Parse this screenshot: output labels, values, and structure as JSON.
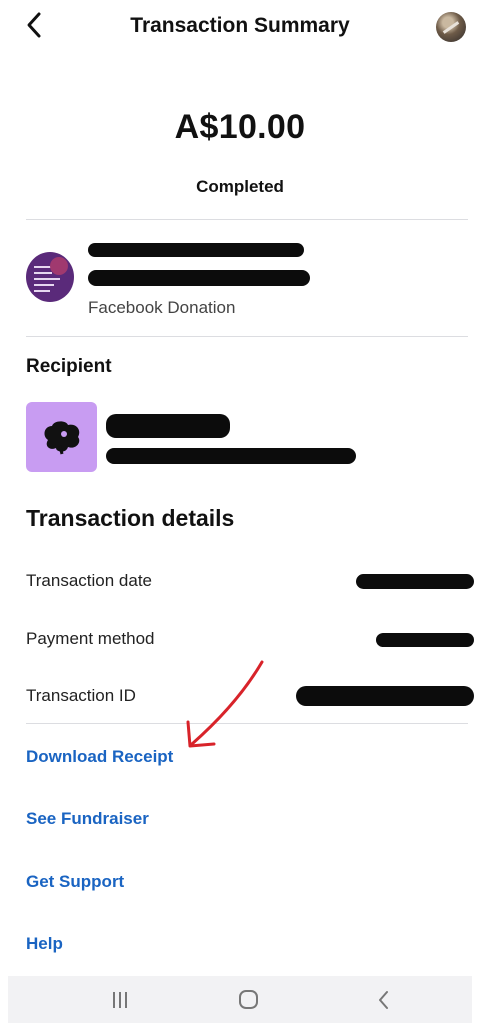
{
  "header": {
    "title": "Transaction Summary",
    "back_icon": "chevron-left-icon",
    "avatar_icon": "profile-avatar"
  },
  "summary": {
    "amount": "A$10.00",
    "status": "Completed"
  },
  "fundraiser": {
    "subtitle": "Facebook Donation"
  },
  "recipient": {
    "heading": "Recipient"
  },
  "details": {
    "heading": "Transaction details",
    "rows": [
      {
        "label": "Transaction date"
      },
      {
        "label": "Payment method"
      },
      {
        "label": "Transaction ID"
      }
    ]
  },
  "links": {
    "download_receipt": "Download Receipt",
    "see_fundraiser": "See Fundraiser",
    "get_support": "Get Support",
    "help": "Help"
  },
  "colors": {
    "link": "#1a64c2",
    "recipient_tile": "#c89cf2",
    "fundraiser_thumb": "#5a2a7a",
    "annotation_arrow": "#d8232a"
  },
  "system_nav": {
    "recents_icon": "recents-icon",
    "home_icon": "home-icon",
    "back_icon": "back-icon"
  }
}
